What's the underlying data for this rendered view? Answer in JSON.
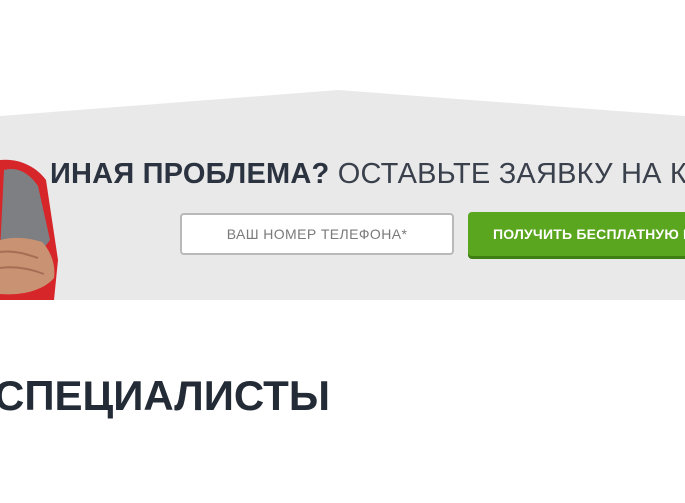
{
  "promo": {
    "headline_strong": "ИНАЯ ПРОБЛЕМА?",
    "headline_rest": "ОСТАВЬТЕ ЗАЯВКУ НА КОНСУ",
    "phone_placeholder": "ВАШ НОМЕР ТЕЛЕФОНА*",
    "cta_label": "ПОЛУЧИТЬ БЕСПЛАТНУЮ К",
    "accent_color": "#5aa61e",
    "band_color": "#e9e9e9"
  },
  "section": {
    "title": "СПЕЦИАЛИСТЫ"
  }
}
